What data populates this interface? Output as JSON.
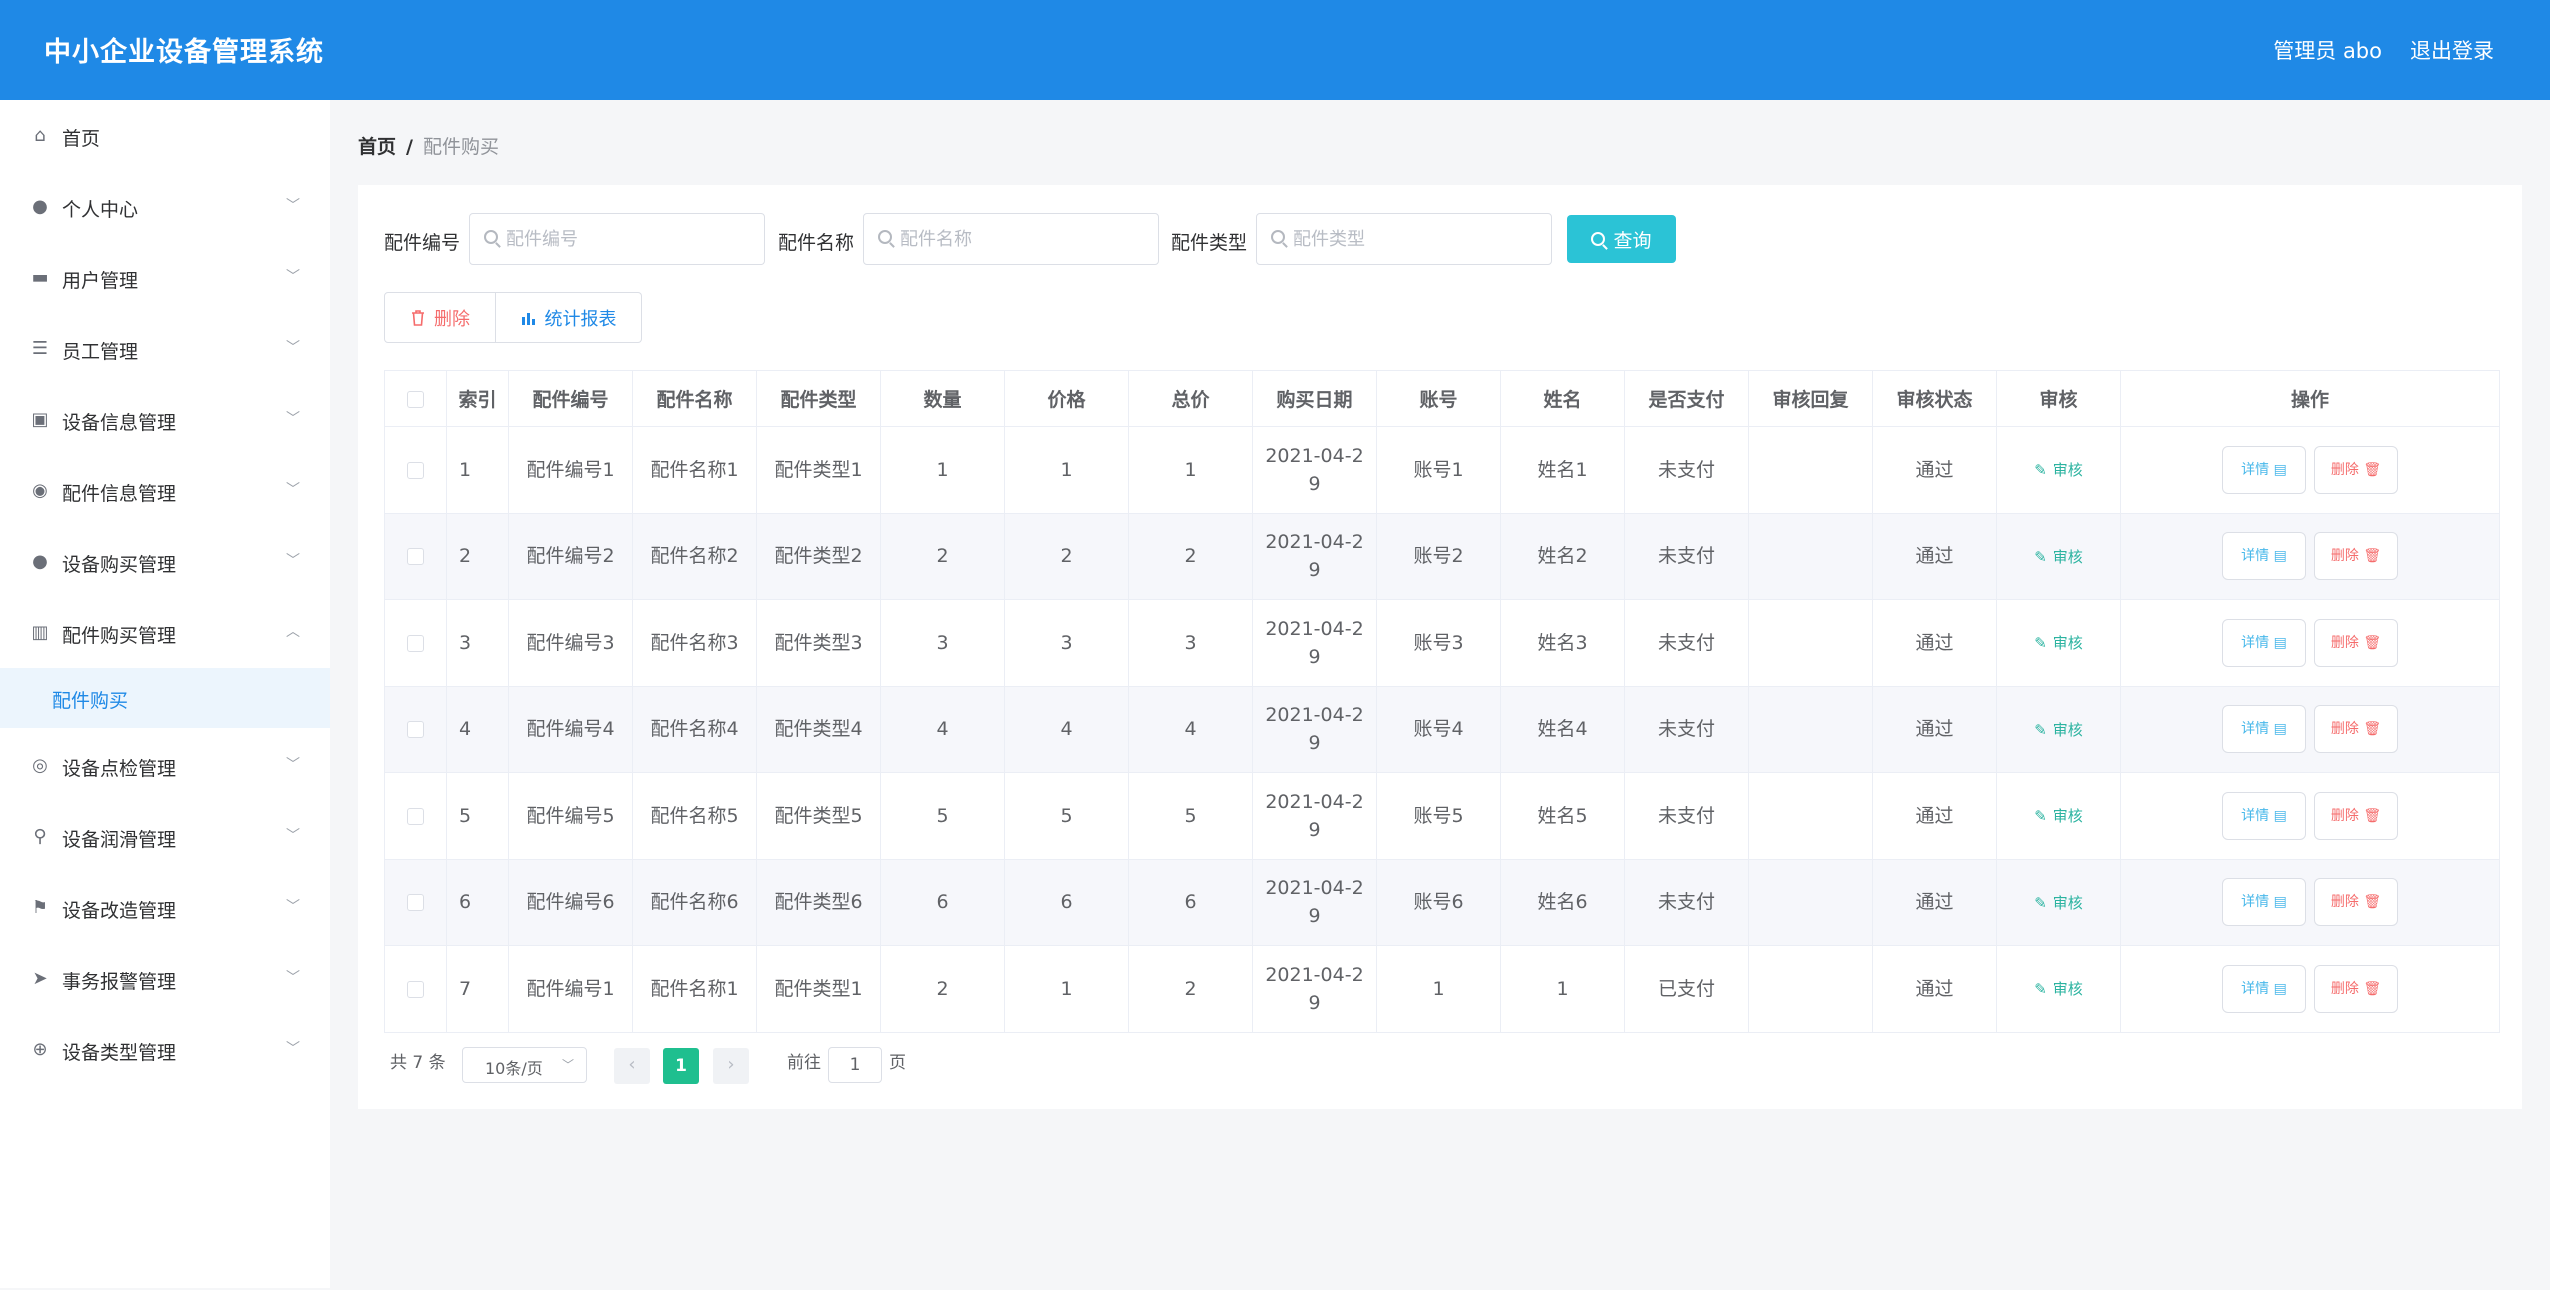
{
  "header": {
    "title": "中小企业设备管理系统",
    "user": "管理员 abo",
    "logout": "退出登录"
  },
  "sidebar": {
    "items": [
      {
        "label": "首页",
        "icon": "home-icon",
        "glyph": "⌂",
        "has_arrow": false
      },
      {
        "label": "个人中心",
        "icon": "user-icon",
        "glyph": "●",
        "has_arrow": true
      },
      {
        "label": "用户管理",
        "icon": "monitor-icon",
        "glyph": "▬",
        "has_arrow": true
      },
      {
        "label": "员工管理",
        "icon": "sliders-icon",
        "glyph": "☰",
        "has_arrow": true
      },
      {
        "label": "设备信息管理",
        "icon": "clipboard-icon",
        "glyph": "▣",
        "has_arrow": true
      },
      {
        "label": "配件信息管理",
        "icon": "location-icon",
        "glyph": "◉",
        "has_arrow": true
      },
      {
        "label": "设备购买管理",
        "icon": "user-icon",
        "glyph": "●",
        "has_arrow": true
      },
      {
        "label": "配件购买管理",
        "icon": "office-icon",
        "glyph": "▥",
        "has_arrow": true,
        "expanded": true
      },
      {
        "label": "设备点检管理",
        "icon": "compass-icon",
        "glyph": "◎",
        "has_arrow": true
      },
      {
        "label": "设备润滑管理",
        "icon": "stamp-icon",
        "glyph": "⚲",
        "has_arrow": true
      },
      {
        "label": "设备改造管理",
        "icon": "flag-icon",
        "glyph": "⚑",
        "has_arrow": true
      },
      {
        "label": "事务报警管理",
        "icon": "send-icon",
        "glyph": "➤",
        "has_arrow": true
      },
      {
        "label": "设备类型管理",
        "icon": "target-icon",
        "glyph": "⊕",
        "has_arrow": true
      }
    ],
    "sub_active": "配件购买"
  },
  "breadcrumb": {
    "home": "首页",
    "separator": "/",
    "current": "配件购买"
  },
  "filters": {
    "code_label": "配件编号",
    "code_placeholder": "配件编号",
    "name_label": "配件名称",
    "name_placeholder": "配件名称",
    "type_label": "配件类型",
    "type_placeholder": "配件类型",
    "query": "查询"
  },
  "actions": {
    "delete": "删除",
    "report": "统计报表"
  },
  "table": {
    "columns": [
      "索引",
      "配件编号",
      "配件名称",
      "配件类型",
      "数量",
      "价格",
      "总价",
      "购买日期",
      "账号",
      "姓名",
      "是否支付",
      "审核回复",
      "审核状态",
      "审核",
      "操作"
    ],
    "audit_label": "审核",
    "detail_label": "详情",
    "delete_label": "删除",
    "rows": [
      {
        "idx": "1",
        "code": "配件编号1",
        "name": "配件名称1",
        "type": "配件类型1",
        "qty": "1",
        "price": "1",
        "total": "1",
        "date": "2021-04-29",
        "account": "账号1",
        "person": "姓名1",
        "paid": "未支付",
        "reply": "",
        "status": "通过"
      },
      {
        "idx": "2",
        "code": "配件编号2",
        "name": "配件名称2",
        "type": "配件类型2",
        "qty": "2",
        "price": "2",
        "total": "2",
        "date": "2021-04-29",
        "account": "账号2",
        "person": "姓名2",
        "paid": "未支付",
        "reply": "",
        "status": "通过"
      },
      {
        "idx": "3",
        "code": "配件编号3",
        "name": "配件名称3",
        "type": "配件类型3",
        "qty": "3",
        "price": "3",
        "total": "3",
        "date": "2021-04-29",
        "account": "账号3",
        "person": "姓名3",
        "paid": "未支付",
        "reply": "",
        "status": "通过"
      },
      {
        "idx": "4",
        "code": "配件编号4",
        "name": "配件名称4",
        "type": "配件类型4",
        "qty": "4",
        "price": "4",
        "total": "4",
        "date": "2021-04-29",
        "account": "账号4",
        "person": "姓名4",
        "paid": "未支付",
        "reply": "",
        "status": "通过"
      },
      {
        "idx": "5",
        "code": "配件编号5",
        "name": "配件名称5",
        "type": "配件类型5",
        "qty": "5",
        "price": "5",
        "total": "5",
        "date": "2021-04-29",
        "account": "账号5",
        "person": "姓名5",
        "paid": "未支付",
        "reply": "",
        "status": "通过"
      },
      {
        "idx": "6",
        "code": "配件编号6",
        "name": "配件名称6",
        "type": "配件类型6",
        "qty": "6",
        "price": "6",
        "total": "6",
        "date": "2021-04-29",
        "account": "账号6",
        "person": "姓名6",
        "paid": "未支付",
        "reply": "",
        "status": "通过"
      },
      {
        "idx": "7",
        "code": "配件编号1",
        "name": "配件名称1",
        "type": "配件类型1",
        "qty": "2",
        "price": "1",
        "total": "2",
        "date": "2021-04-29",
        "account": "1",
        "person": "1",
        "paid": "已支付",
        "reply": "",
        "status": "通过"
      }
    ]
  },
  "pagination": {
    "total": "共 7 条",
    "page_size": "10条/页",
    "current": "1",
    "goto_label": "前往",
    "goto_value": "1",
    "page_unit": "页"
  },
  "colors": {
    "header": "#1f89e6",
    "query_button": "#2bc3d6",
    "current_page": "#1fbf8f",
    "danger": "#f56c6c",
    "audit": "#2bb3a0"
  }
}
